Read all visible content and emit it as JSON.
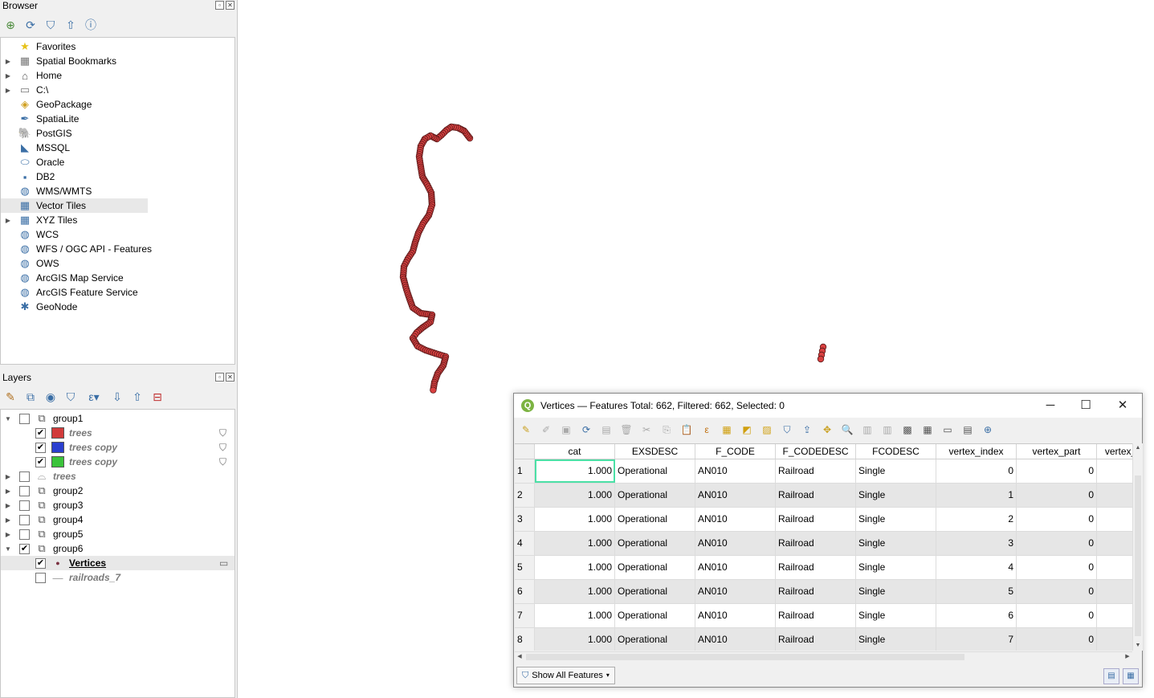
{
  "browser": {
    "title": "Browser",
    "items": [
      {
        "label": "Favorites",
        "icon": "star-icon",
        "expandable": false
      },
      {
        "label": "Spatial Bookmarks",
        "icon": "bookmarks-icon",
        "expandable": true
      },
      {
        "label": "Home",
        "icon": "home-icon",
        "expandable": true
      },
      {
        "label": "C:\\",
        "icon": "folder-icon",
        "expandable": true
      },
      {
        "label": "GeoPackage",
        "icon": "geopackage-icon",
        "expandable": false
      },
      {
        "label": "SpatiaLite",
        "icon": "spatialite-icon",
        "expandable": false
      },
      {
        "label": "PostGIS",
        "icon": "postgis-icon",
        "expandable": false
      },
      {
        "label": "MSSQL",
        "icon": "mssql-icon",
        "expandable": false
      },
      {
        "label": "Oracle",
        "icon": "oracle-icon",
        "expandable": false
      },
      {
        "label": "DB2",
        "icon": "db2-icon",
        "expandable": false
      },
      {
        "label": "WMS/WMTS",
        "icon": "globe-icon",
        "expandable": false
      },
      {
        "label": "Vector Tiles",
        "icon": "grid-icon",
        "expandable": false
      },
      {
        "label": "XYZ Tiles",
        "icon": "grid-icon",
        "expandable": true
      },
      {
        "label": "WCS",
        "icon": "globe-icon",
        "expandable": false
      },
      {
        "label": "WFS / OGC API - Features",
        "icon": "globe-icon",
        "expandable": false
      },
      {
        "label": "OWS",
        "icon": "globe-icon",
        "expandable": false
      },
      {
        "label": "ArcGIS Map Service",
        "icon": "globe-icon",
        "expandable": false
      },
      {
        "label": "ArcGIS Feature Service",
        "icon": "globe-icon",
        "expandable": false
      },
      {
        "label": "GeoNode",
        "icon": "geonode-icon",
        "expandable": false
      }
    ]
  },
  "layers": {
    "title": "Layers",
    "items": [
      {
        "label": "group1",
        "type": "group",
        "checked": false,
        "expanded": true
      },
      {
        "label": "trees",
        "type": "layer",
        "checked": true,
        "color": "#d13b3b",
        "filter": true
      },
      {
        "label": "trees copy",
        "type": "layer",
        "checked": true,
        "color": "#2b3fcf",
        "filter": true
      },
      {
        "label": "trees copy",
        "type": "layer",
        "checked": true,
        "color": "#3bc33b",
        "filter": true
      },
      {
        "label": "trees",
        "type": "layer-group",
        "checked": false,
        "expanded": false
      },
      {
        "label": "group2",
        "type": "group",
        "checked": false,
        "expanded": false
      },
      {
        "label": "group3",
        "type": "group",
        "checked": false,
        "expanded": false
      },
      {
        "label": "group4",
        "type": "group",
        "checked": false,
        "expanded": false
      },
      {
        "label": "group5",
        "type": "group",
        "checked": false,
        "expanded": false
      },
      {
        "label": "group6",
        "type": "group",
        "checked": true,
        "expanded": true
      },
      {
        "label": "Vertices",
        "type": "point-layer",
        "checked": true
      },
      {
        "label": "railroads_7",
        "type": "line-layer",
        "checked": false
      }
    ]
  },
  "attribute_table": {
    "title": "Vertices — Features Total: 662, Filtered: 662, Selected: 0",
    "columns": [
      "cat",
      "EXSDESC",
      "F_CODE",
      "F_CODEDESC",
      "FCODESC",
      "vertex_index",
      "vertex_part",
      "vertex_"
    ],
    "rows": [
      {
        "n": "1",
        "cat": "1.000",
        "exsdesc": "Operational",
        "fcode": "AN010",
        "fcodedesc": "Railroad",
        "fcodesc": "Single",
        "vertex_index": "0",
        "vertex_part": "0"
      },
      {
        "n": "2",
        "cat": "1.000",
        "exsdesc": "Operational",
        "fcode": "AN010",
        "fcodedesc": "Railroad",
        "fcodesc": "Single",
        "vertex_index": "1",
        "vertex_part": "0"
      },
      {
        "n": "3",
        "cat": "1.000",
        "exsdesc": "Operational",
        "fcode": "AN010",
        "fcodedesc": "Railroad",
        "fcodesc": "Single",
        "vertex_index": "2",
        "vertex_part": "0"
      },
      {
        "n": "4",
        "cat": "1.000",
        "exsdesc": "Operational",
        "fcode": "AN010",
        "fcodedesc": "Railroad",
        "fcodesc": "Single",
        "vertex_index": "3",
        "vertex_part": "0"
      },
      {
        "n": "5",
        "cat": "1.000",
        "exsdesc": "Operational",
        "fcode": "AN010",
        "fcodedesc": "Railroad",
        "fcodesc": "Single",
        "vertex_index": "4",
        "vertex_part": "0"
      },
      {
        "n": "6",
        "cat": "1.000",
        "exsdesc": "Operational",
        "fcode": "AN010",
        "fcodedesc": "Railroad",
        "fcodesc": "Single",
        "vertex_index": "5",
        "vertex_part": "0"
      },
      {
        "n": "7",
        "cat": "1.000",
        "exsdesc": "Operational",
        "fcode": "AN010",
        "fcodedesc": "Railroad",
        "fcodesc": "Single",
        "vertex_index": "6",
        "vertex_part": "0"
      },
      {
        "n": "8",
        "cat": "1.000",
        "exsdesc": "Operational",
        "fcode": "AN010",
        "fcodedesc": "Railroad",
        "fcodesc": "Single",
        "vertex_index": "7",
        "vertex_part": "0"
      }
    ],
    "show_all_label": "Show All Features"
  },
  "colors": {
    "vertex_fill": "#d94040",
    "vertex_stroke": "#5a1a1a",
    "focus": "#4be0a6"
  }
}
